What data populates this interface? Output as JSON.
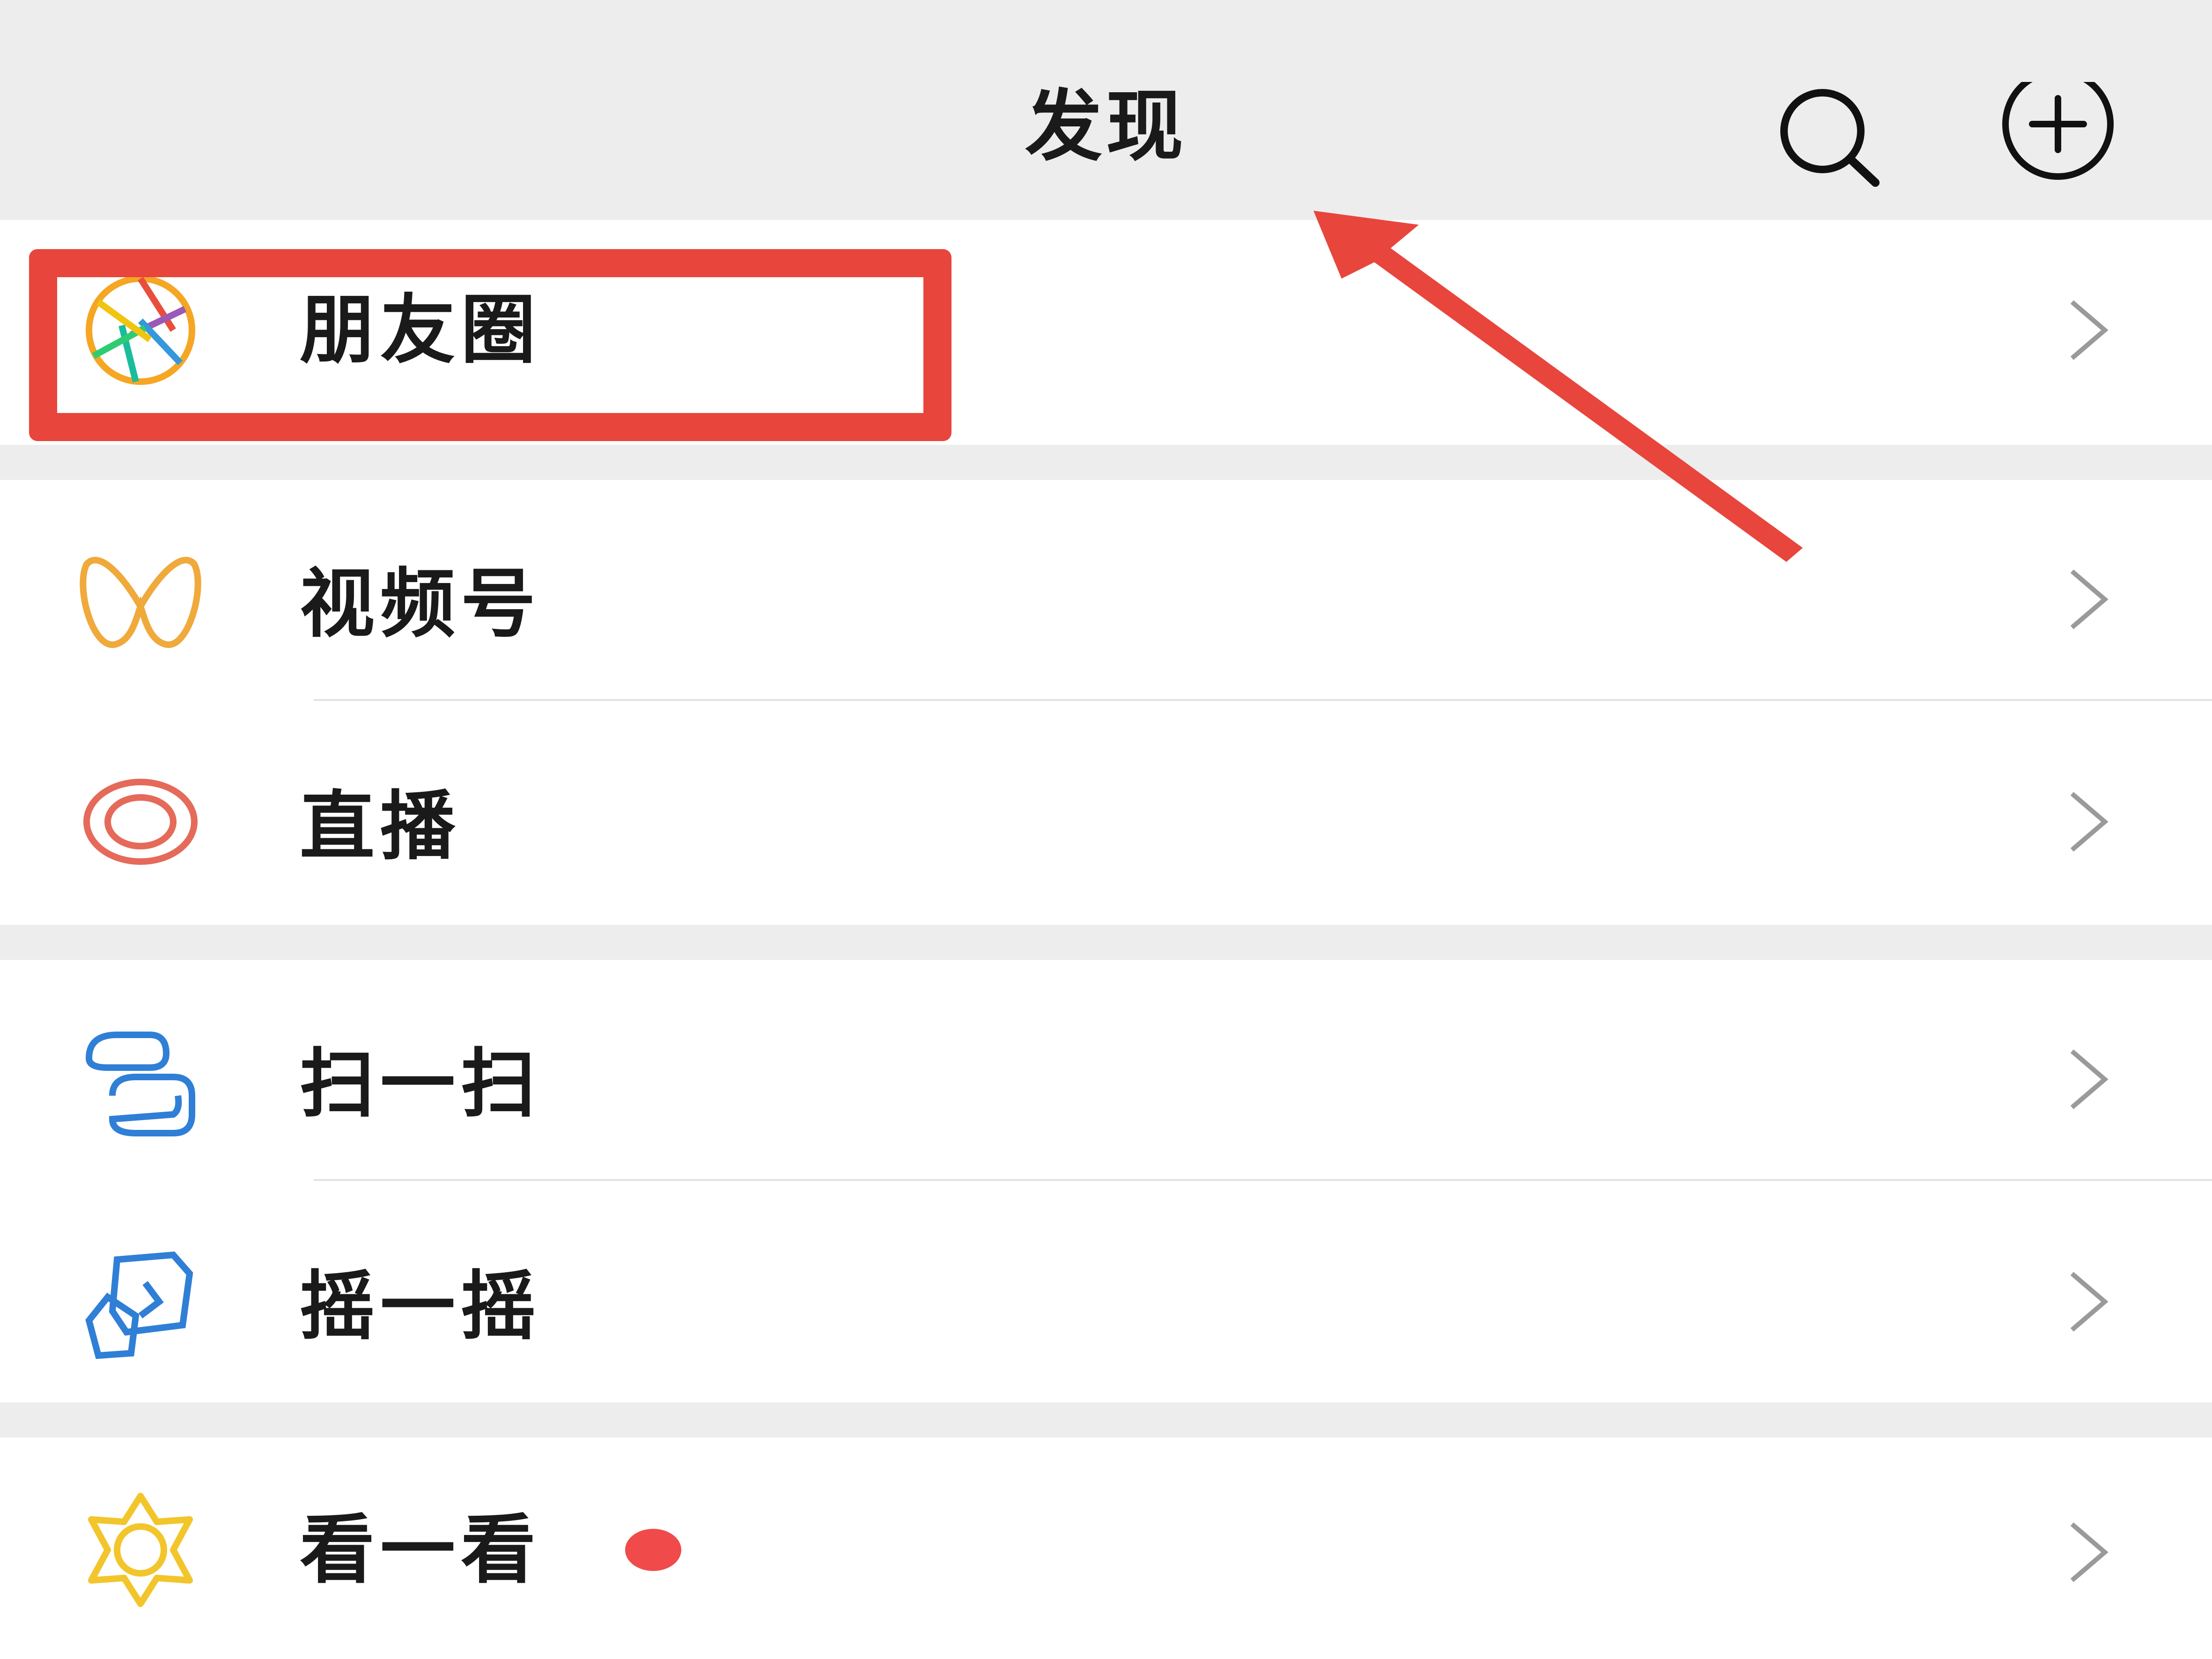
{
  "header": {
    "title": "发现",
    "search_icon": "search-icon",
    "add_icon": "add-circle-icon"
  },
  "menu": {
    "group1": [
      {
        "label": "朋友圈",
        "icon": "moments-aperture-icon"
      }
    ],
    "group2": [
      {
        "label": "视频号",
        "icon": "channels-icon"
      },
      {
        "label": "直播",
        "icon": "live-icon"
      }
    ],
    "group3": [
      {
        "label": "扫一扫",
        "icon": "scan-icon"
      },
      {
        "label": "摇一摇",
        "icon": "shake-icon"
      }
    ],
    "group4": [
      {
        "label": "看一看",
        "icon": "top-stories-icon",
        "badge": "red-dot"
      }
    ]
  },
  "annotation": {
    "highlight_color": "#e8453c",
    "highlight_target": "朋友圈"
  },
  "colors": {
    "background": "#ededed",
    "card": "#ffffff",
    "annotation_red": "#e8453c",
    "badge_red": "#f04a4a",
    "channels_orange": "#f0a93b",
    "live_red": "#e56a5a",
    "scan_blue": "#2f7fd6",
    "top_stories_yellow": "#f2c52b"
  }
}
